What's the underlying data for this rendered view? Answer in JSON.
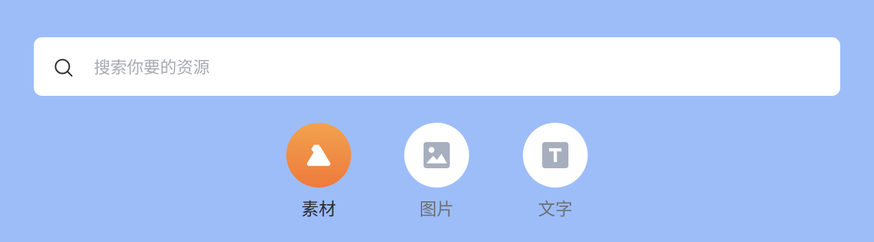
{
  "search": {
    "placeholder": "搜索你要的资源",
    "value": "",
    "icon": "search-icon"
  },
  "categories": [
    {
      "label": "素材",
      "icon": "material-triangle-icon",
      "active": true,
      "color": "#ef8a41"
    },
    {
      "label": "图片",
      "icon": "image-icon",
      "active": false,
      "color": "#a7afbf"
    },
    {
      "label": "文字",
      "icon": "text-t-icon",
      "active": false,
      "color": "#a7afbf"
    }
  ],
  "colors": {
    "background": "#9dbdf9",
    "accent": "#ef8a41",
    "icon_gray": "#a7afbf"
  }
}
